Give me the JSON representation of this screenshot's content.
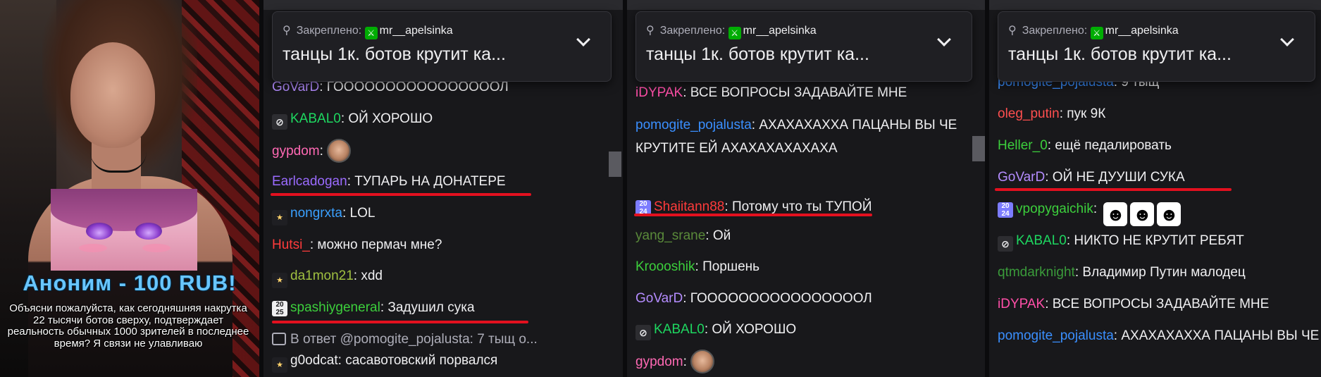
{
  "stream": {
    "donation_title": "Аноним - 100 RUB!",
    "donation_text": "Объясни пожалуйста, как сегодняшняя накрутка 22 тысячи ботов сверху, подтверждает реальность обычных 1000 зрителей в последнее время? Я связи не улавливаю"
  },
  "pinned": {
    "label": "Закреплено:",
    "user": "mr__apelsinka",
    "text": "танцы 1к. ботов крутит ка..."
  },
  "colors": {
    "red_underline": "#e3101f",
    "donation_blue": "#69c6ff"
  },
  "chat1": {
    "messages": [
      {
        "user": "GoVarD",
        "color": "#b48cff",
        "sep": ": ",
        "text": "ГООООООООООООООООЛ"
      },
      {
        "user": "KABAL0",
        "color": "#1ed760",
        "sep": ": ",
        "text": "ОЙ ХОРОШО",
        "badge": "mod-icon"
      },
      {
        "user": "gypdom",
        "color": "#ff69b4",
        "sep": ": ",
        "text": "",
        "emote": "face-emote"
      },
      {
        "user": "Earlcadogan",
        "color": "#9b6bff",
        "sep": ": ",
        "text": "ТУПАРЬ НА ДОНАТЕРЕ"
      },
      {
        "user": "nongrxta",
        "color": "#3aa0ff",
        "sep": ": ",
        "text": "LOL",
        "badge": "sub-icon"
      },
      {
        "user": "Hutsi_",
        "color": "#ff3b3b",
        "sep": ": ",
        "text": "можно пермач мне?"
      },
      {
        "user": "da1mon21",
        "color": "#a0c040",
        "sep": ": ",
        "text": "xdd",
        "badge": "sub-icon"
      },
      {
        "user": "spashiygeneral",
        "color": "#3ccf3c",
        "sep": ": ",
        "text": "Задушил сука",
        "badge": "year-2025-icon"
      },
      {
        "reply": "В ответ @pomogite_pojalusta: 7 тыщ о..."
      },
      {
        "user": "g0odcat",
        "color": "#efeff1",
        "sep": ": ",
        "text": "сасавотовский порвался",
        "badge": "sub-icon"
      }
    ]
  },
  "chat2": {
    "messages": [
      {
        "user": "iDYPAK",
        "color": "#ff4fa8",
        "sep": ": ",
        "text": "ВСЕ ВОПРОСЫ ЗАДАВАЙТЕ МНЕ"
      },
      {
        "user": "pomogite_pojalusta",
        "color": "#3a8fff",
        "sep": ": ",
        "text": "АХАХАХАХХА ПАЦАНЫ ВЫ ЧЕ КРУТИТЕ ЕЙ АХАХАХАХАХАХА"
      },
      {
        "user": "Shaiitann88",
        "color": "#ff3b3b",
        "sep": ": ",
        "text": "Потому что ты ТУПОЙ",
        "badge": "year-2024-icon"
      },
      {
        "user": "yang_srane",
        "color": "#5a8a3a",
        "sep": ": ",
        "text": "Ой"
      },
      {
        "user": "Kroooshik",
        "color": "#3ccf3c",
        "sep": ": ",
        "text": "Поршень"
      },
      {
        "user": "GoVarD",
        "color": "#b48cff",
        "sep": ": ",
        "text": "ГООООООООООООООООЛ"
      },
      {
        "user": "KABAL0",
        "color": "#1ed760",
        "sep": ": ",
        "text": "ОЙ ХОРОШО",
        "badge": "mod-icon"
      },
      {
        "user": "gypdom",
        "color": "#ff69b4",
        "sep": ": ",
        "text": "",
        "emote": "face-emote"
      }
    ]
  },
  "chat3": {
    "messages": [
      {
        "user": "pomogite_pojalusta",
        "color": "#3a8fff",
        "sep": ": ",
        "text": "9 тыщ"
      },
      {
        "user": "oleg_putin",
        "color": "#ff4f4f",
        "sep": ": ",
        "text": "пук 9К"
      },
      {
        "user": "Heller_0",
        "color": "#3ccf3c",
        "sep": ": ",
        "text": "ещё педалировать"
      },
      {
        "user": "GoVarD",
        "color": "#b48cff",
        "sep": ": ",
        "text": "ОЙ НЕ ДУУШИ СУКА"
      },
      {
        "user": "vpopygaichik",
        "color": "#3ccf3c",
        "sep": ": ",
        "text": "",
        "badge": "year-2024-icon",
        "emote": "smile-emotes"
      },
      {
        "user": "KABAL0",
        "color": "#1ed760",
        "sep": ": ",
        "text": "НИКТО НЕ КРУТИТ РЕБЯТ",
        "badge": "mod-icon"
      },
      {
        "user": "qtmdarknight",
        "color": "#3a9a3a",
        "sep": ": ",
        "text": "Владимир Путин малодец"
      },
      {
        "user": "iDYPAK",
        "color": "#ff4fa8",
        "sep": ": ",
        "text": "ВСЕ ВОПРОСЫ ЗАДАВАЙТЕ МНЕ"
      },
      {
        "user": "pomogite_pojalusta",
        "color": "#3a8fff",
        "sep": ": ",
        "text": "АХАХАХАХХА ПАЦАНЫ ВЫ ЧЕ КРУТИТЕ ЕЙ"
      }
    ]
  }
}
